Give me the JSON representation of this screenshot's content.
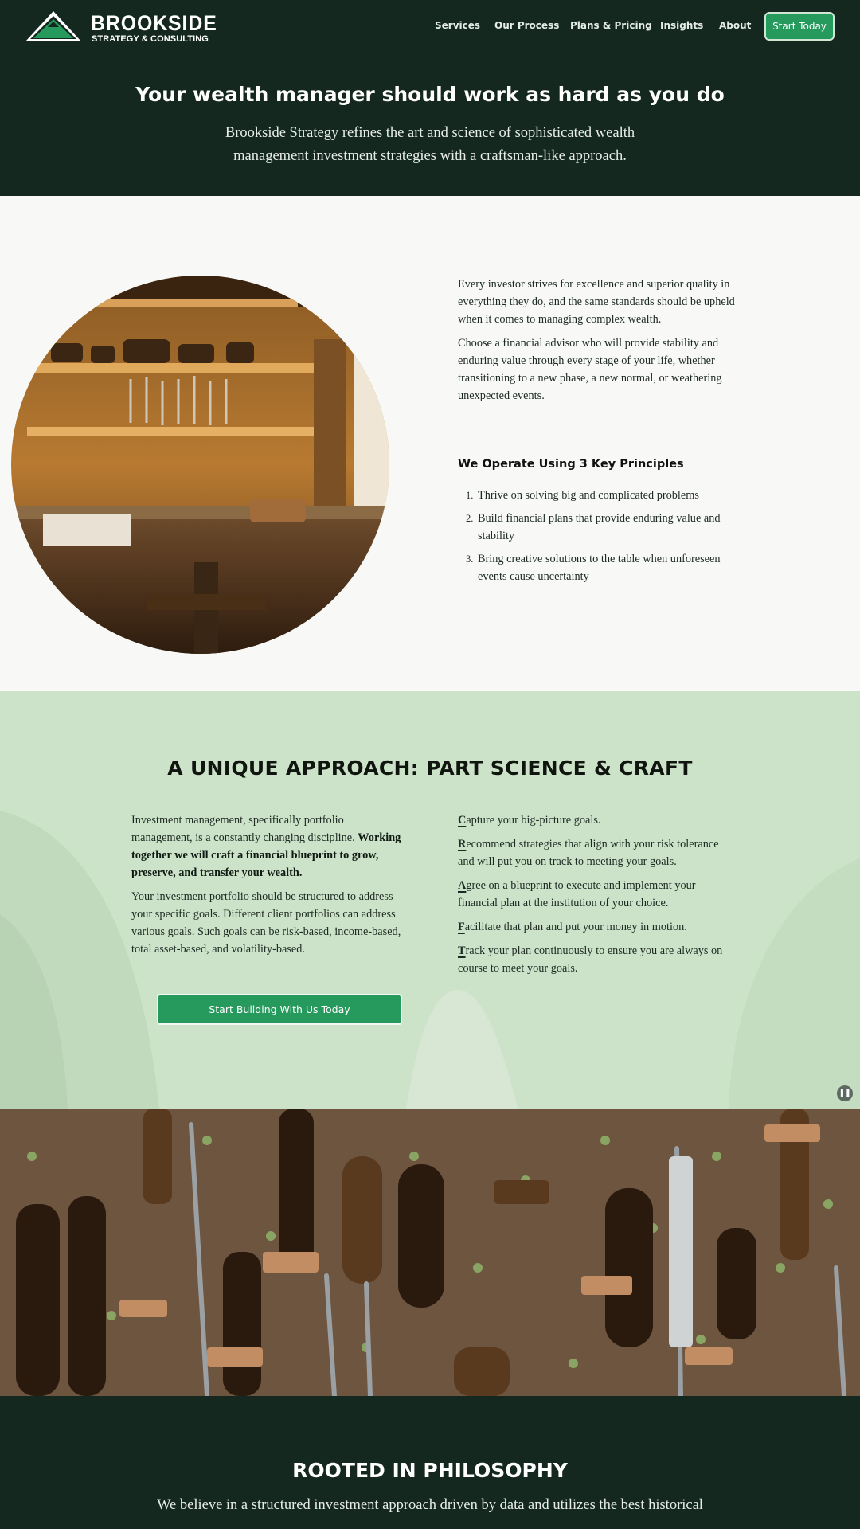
{
  "header": {
    "logo_name": "BROOKSIDE",
    "logo_tagline": "STRATEGY & CONSULTING",
    "nav": [
      {
        "label": "Services"
      },
      {
        "label": "Our Process"
      },
      {
        "label": "Plans & Pricing"
      },
      {
        "label": "Insights"
      },
      {
        "label": "About"
      }
    ],
    "cta_label": "Start Today",
    "active_nav": "Our Process"
  },
  "hero": {
    "title": "Your wealth manager should work as hard as you do",
    "subtitle": "Brookside Strategy refines the art and science of sophisticated wealth management investment strategies with a craftsman-like approach."
  },
  "intro": {
    "paragraphs": [
      "Every investor strives for excellence and superior quality in everything they do, and the same standards should be upheld when it comes to managing complex wealth.",
      "Choose a financial advisor who will provide stability and enduring value through every stage of your life, whether transitioning to a new phase, a new normal, or weathering unexpected events."
    ],
    "principles_title": "We Operate Using 3 Key Principles",
    "principles": [
      {
        "num": "1.",
        "text": "Thrive on solving big and complicated problems"
      },
      {
        "num": "2.",
        "text": "Build financial plans that provide enduring value and stability"
      },
      {
        "num": "3.",
        "text": "Bring creative solutions to the table when unforeseen events cause uncertainty"
      }
    ]
  },
  "approach": {
    "title": "A UNIQUE APPROACH: PART SCIENCE & CRAFT",
    "left_p1": "Investment management, specifically portfolio management, is a constantly changing discipline.",
    "left_p1_bold": "Working together we will craft a financial blueprint to grow, preserve, and transfer your wealth.",
    "left_p2": "Your investment portfolio should be structured to address your specific goals. Different client portfolios can address various goals. Such goals can be risk-based, income-based, total asset-based, and volatility-based.",
    "steps": [
      {
        "initial": "C",
        "rest": "apture your big-picture goals."
      },
      {
        "initial": "R",
        "rest": "ecommend strategies that align with your risk tolerance and will put you on track to meeting your goals."
      },
      {
        "initial": "A",
        "rest": "gree on a blueprint to execute and implement your financial plan at the institution of your choice."
      },
      {
        "initial": "F",
        "rest": "acilitate that plan and put your money in motion."
      },
      {
        "initial": "T",
        "rest": "rack your plan continuously to ensure you are always on course to meet your goals."
      }
    ],
    "cta_label": "Start Building With Us Today"
  },
  "philosophy": {
    "title": "ROOTED IN PHILOSOPHY",
    "text": "We believe in a structured investment approach driven by data and utilizes the best historical"
  },
  "colors": {
    "dark_green": "#14281f",
    "accent_green": "#269a5d",
    "light_green": "#cde3c9",
    "off_white": "#f8f9f7"
  }
}
